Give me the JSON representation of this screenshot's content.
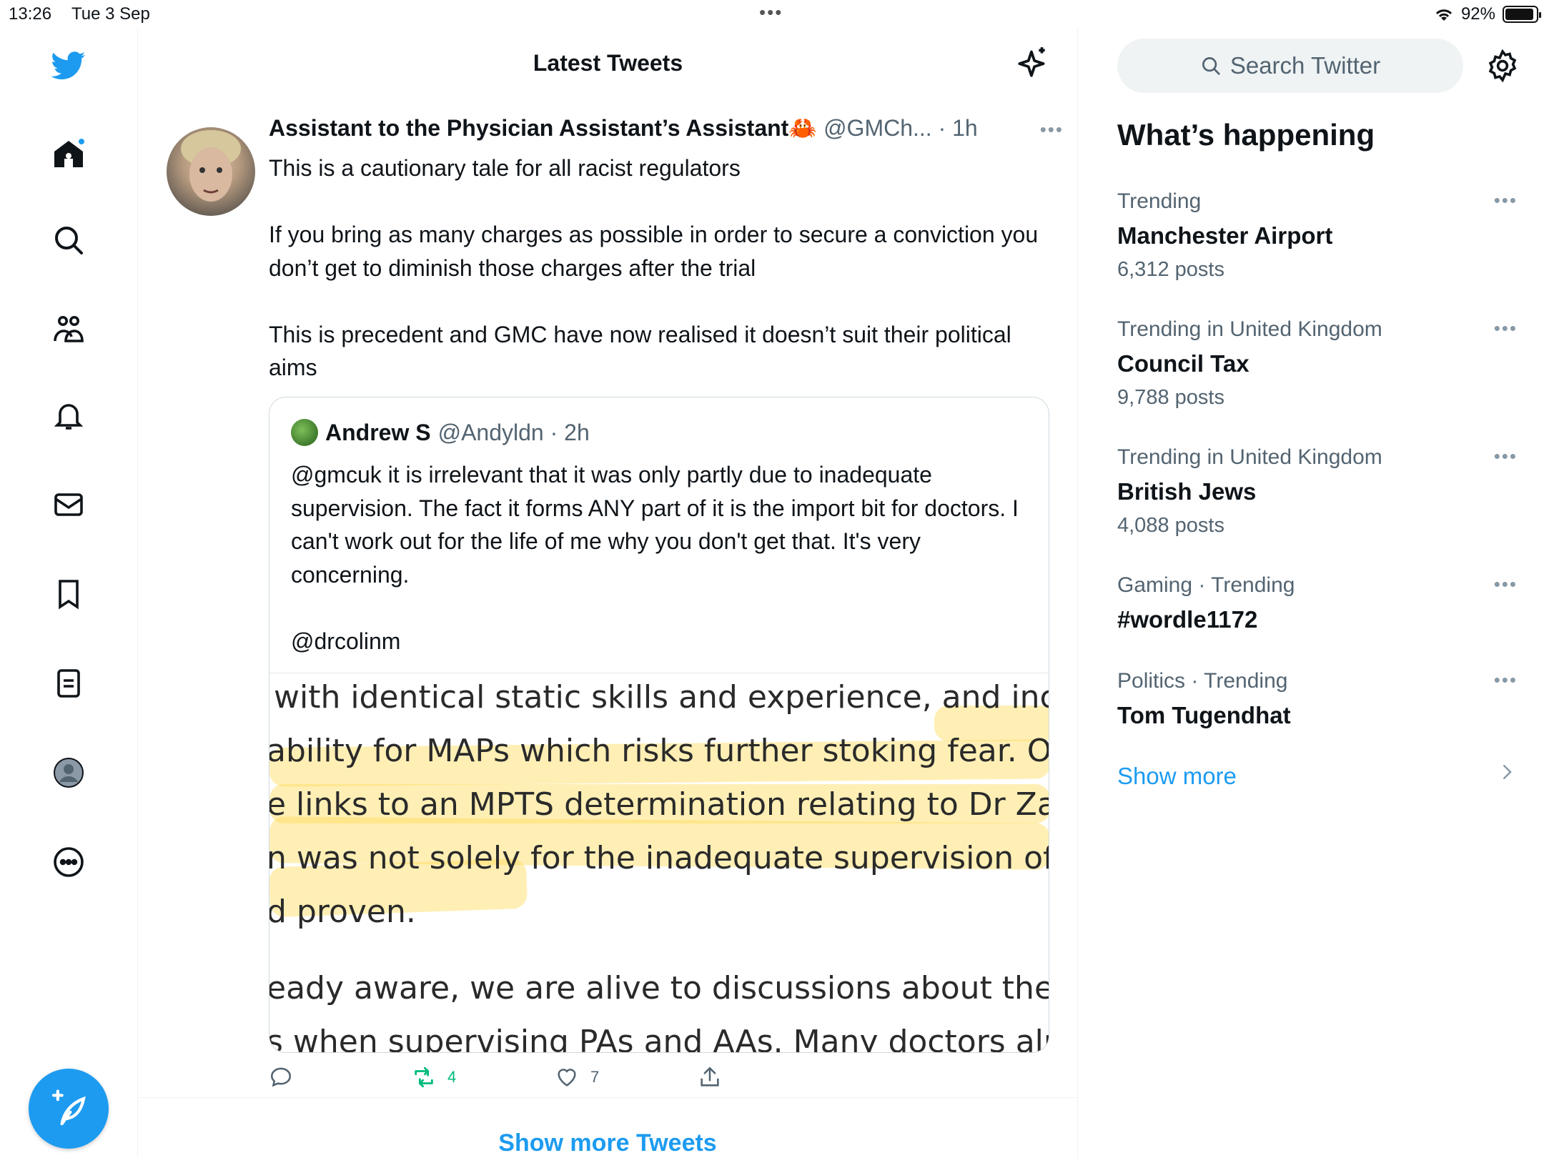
{
  "status_bar": {
    "time": "13:26",
    "date": "Tue 3 Sep",
    "battery": "92%"
  },
  "nav": {
    "items": [
      "home-icon",
      "search-icon",
      "communities-icon",
      "notifications-icon",
      "messages-icon",
      "bookmarks-icon",
      "lists-icon",
      "profile-icon",
      "more-icon"
    ],
    "compose": "compose-tweet-icon"
  },
  "main": {
    "title": "Latest Tweets",
    "tweet": {
      "name": "Assistant to the Physician Assistant’s Assistant🦀",
      "handle": "@GMCh... · 1h",
      "text": "This is a cautionary tale for all racist regulators\n\nIf you bring as many charges as possible in order to secure a conviction you don’t get to diminish those charges after the trial\n\nThis is precedent and GMC have now realised it doesn’t suit their political aims",
      "quote": {
        "name": "Andrew S",
        "handle": "@Andyldn · 2h",
        "text": "@gmcuk it is irrelevant that it was only partly due to inadequate supervision. The fact it forms ANY part of it is the import bit for doctors. I can't work out for the life of me why you don't get that. It's very concerning.\n\n@drcolinm",
        "image_lines": [
          "with identical static skills and experience, and incluc",
          "ability for MAPs which risks further stoking fear. On t",
          "e links to an MPTS determination relating to Dr Zaw.",
          "n was not solely for the inadequate supervision of a",
          "d proven.",
          "eady aware, we are alive to discussions about the res",
          "s when supervising PAs and AAs. Many doctors alrea"
        ]
      },
      "retweets": "4",
      "likes": "7"
    },
    "show_more": "Show more Tweets"
  },
  "sidebar": {
    "search_placeholder": "Search Twitter",
    "title": "What’s happening",
    "trends": [
      {
        "meta": "Trending",
        "name": "Manchester Airport",
        "count": "6,312 posts"
      },
      {
        "meta": "Trending in United Kingdom",
        "name": "Council Tax",
        "count": "9,788 posts"
      },
      {
        "meta": "Trending in United Kingdom",
        "name": "British Jews",
        "count": "4,088 posts"
      },
      {
        "meta": "Gaming · Trending",
        "name": "#wordle1172",
        "count": ""
      },
      {
        "meta": "Politics · Trending",
        "name": "Tom Tugendhat",
        "count": ""
      }
    ],
    "show_more": "Show more"
  },
  "colors": {
    "accent": "#1d9bf0",
    "retweet_green": "#00ba7c",
    "secondary_text": "#536471"
  }
}
